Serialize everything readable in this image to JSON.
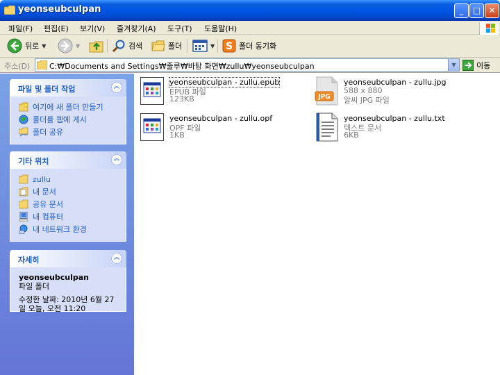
{
  "window": {
    "title": "yeonseubculpan",
    "min_label": "_",
    "max_label": "□",
    "close_label": "✕"
  },
  "menu": {
    "items": [
      "파일(F)",
      "편집(E)",
      "보기(V)",
      "즐겨찾기(A)",
      "도구(T)",
      "도움말(H)"
    ]
  },
  "toolbar": {
    "back_label": "뒤로",
    "search_label": "검색",
    "folders_label": "폴더",
    "sync_label": "폴더 동기화"
  },
  "address": {
    "label": "주소(D)",
    "path": "C:₩Documents and Settings₩줄루₩바탕 화면₩zullu₩yeonseubculpan",
    "go_label": "이동"
  },
  "tasks": {
    "title": "파일 및 폴더 작업",
    "items": [
      {
        "label": "여기에 새 폴더 만들기",
        "icon": "new-folder-icon"
      },
      {
        "label": "폴더를 웹에 게시",
        "icon": "publish-web-icon"
      },
      {
        "label": "폴더 공유",
        "icon": "share-folder-icon"
      }
    ]
  },
  "other_places": {
    "title": "기타 위치",
    "items": [
      {
        "label": "zullu",
        "icon": "folder-icon"
      },
      {
        "label": "내 문서",
        "icon": "my-documents-icon"
      },
      {
        "label": "공유 문서",
        "icon": "shared-documents-icon"
      },
      {
        "label": "내 컴퓨터",
        "icon": "my-computer-icon"
      },
      {
        "label": "내 네트워크 환경",
        "icon": "network-icon"
      }
    ]
  },
  "details": {
    "title": "자세히",
    "name": "yeonseubculpan",
    "type": "파일 폴더",
    "modified_line1": "수정한 날짜: 2010년 6월 27",
    "modified_line2": "일 오늘, 오전 11:20"
  },
  "files": [
    {
      "name": "yeonseubculpan - zullu.epub",
      "type": "EPUB 파일",
      "size": "123KB",
      "icon": "epub-file-icon",
      "selected": true
    },
    {
      "name": "yeonseubculpan - zullu.jpg",
      "type": "588 x 880",
      "size": "알씨 JPG 파일",
      "icon": "jpg-file-icon",
      "icon_text": "JPG"
    },
    {
      "name": "yeonseubculpan - zullu.opf",
      "type": "OPF 파일",
      "size": "1KB",
      "icon": "opf-file-icon"
    },
    {
      "name": "yeonseubculpan - zullu.txt",
      "type": "텍스트 문서",
      "size": "6KB",
      "icon": "text-file-icon"
    }
  ]
}
